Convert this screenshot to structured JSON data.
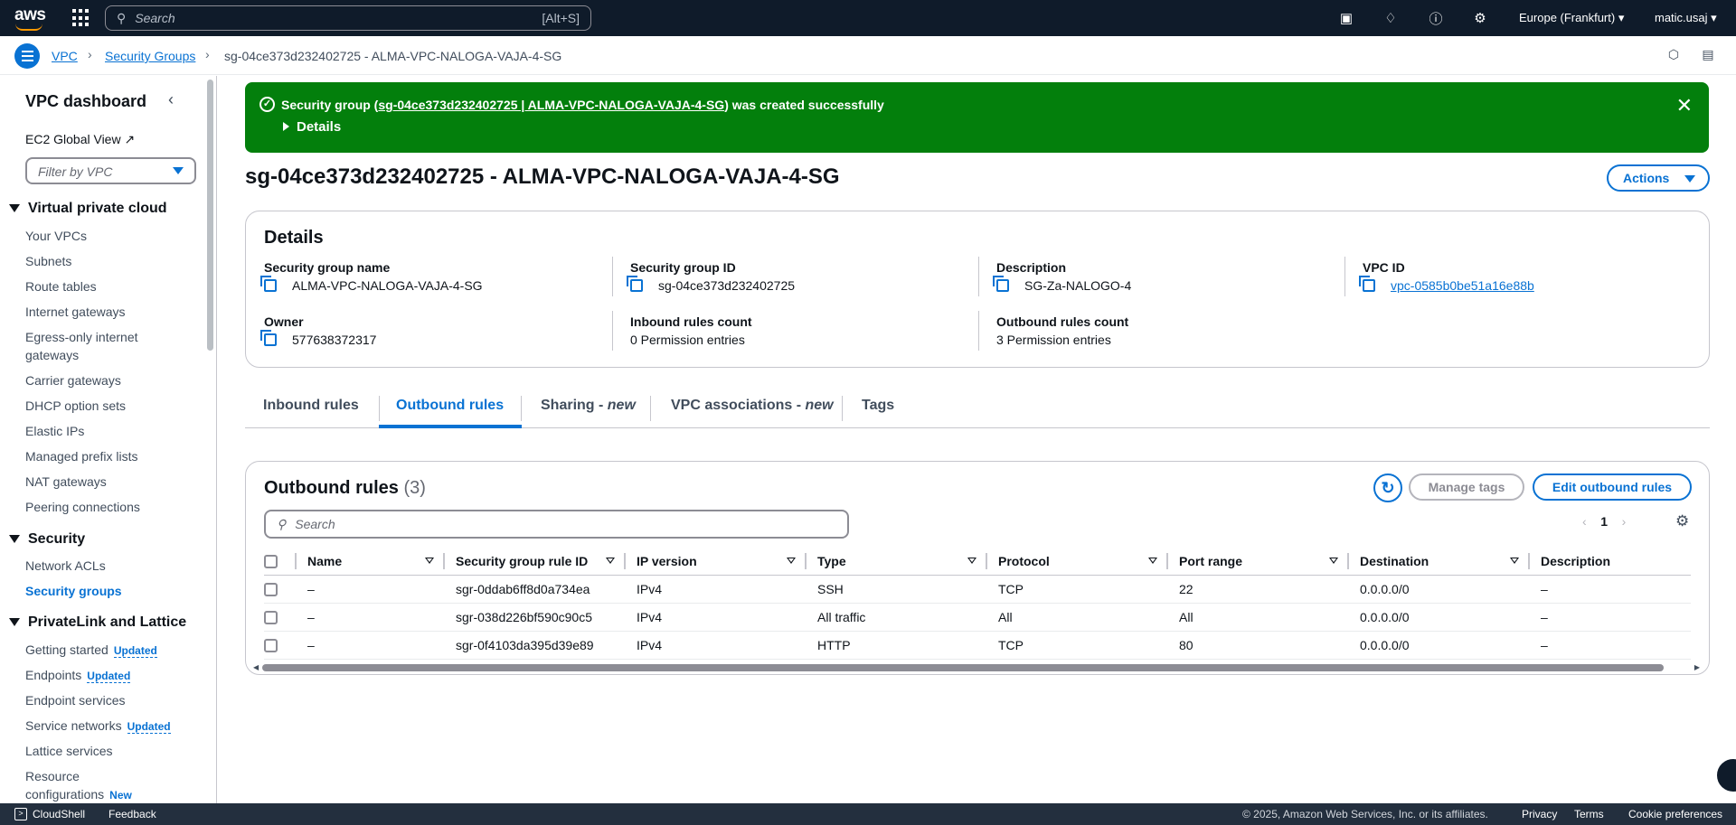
{
  "topnav": {
    "logo_text": "aws",
    "search_placeholder": "Search",
    "search_shortcut": "[Alt+S]",
    "region": "Europe (Frankfurt)",
    "user": "matic.usaj"
  },
  "breadcrumb": {
    "items": [
      "VPC",
      "Security Groups",
      "sg-04ce373d232402725 - ALMA-VPC-NALOGA-VAJA-4-SG"
    ]
  },
  "sidebar": {
    "title": "VPC dashboard",
    "ec2_global_view": "EC2 Global View",
    "filter_placeholder": "Filter by VPC",
    "sections": [
      {
        "title": "Virtual private cloud",
        "items": [
          "Your VPCs",
          "Subnets",
          "Route tables",
          "Internet gateways",
          "Egress-only internet gateways",
          "Carrier gateways",
          "DHCP option sets",
          "Elastic IPs",
          "Managed prefix lists",
          "NAT gateways",
          "Peering connections"
        ]
      },
      {
        "title": "Security",
        "items": [
          "Network ACLs",
          "Security groups"
        ]
      },
      {
        "title": "PrivateLink and Lattice",
        "items": [
          "Getting started",
          "Endpoints",
          "Endpoint services",
          "Service networks",
          "Lattice services",
          "Resource configurations"
        ]
      }
    ],
    "badges": {
      "updated": "Updated",
      "new": "New"
    }
  },
  "flash": {
    "prefix": "Security group (",
    "link": "sg-04ce373d232402725 | ALMA-VPC-NALOGA-VAJA-4-SG",
    "suffix": ") was created successfully",
    "details": "Details"
  },
  "page": {
    "title": "sg-04ce373d232402725 - ALMA-VPC-NALOGA-VAJA-4-SG",
    "actions_label": "Actions"
  },
  "details": {
    "heading": "Details",
    "fields": [
      {
        "label": "Security group name",
        "value": "ALMA-VPC-NALOGA-VAJA-4-SG"
      },
      {
        "label": "Security group ID",
        "value": "sg-04ce373d232402725"
      },
      {
        "label": "Description",
        "value": "SG-Za-NALOGO-4"
      },
      {
        "label": "VPC ID",
        "value": "vpc-0585b0be51a16e88b"
      },
      {
        "label": "Owner",
        "value": "577638372317"
      },
      {
        "label": "Inbound rules count",
        "value": "0 Permission entries"
      },
      {
        "label": "Outbound rules count",
        "value": "3 Permission entries"
      }
    ]
  },
  "tabs": [
    {
      "label": "Inbound rules",
      "suffix": ""
    },
    {
      "label": "Outbound rules",
      "suffix": ""
    },
    {
      "label": "Sharing - ",
      "suffix": "new"
    },
    {
      "label": "VPC associations - ",
      "suffix": "new"
    },
    {
      "label": "Tags",
      "suffix": ""
    }
  ],
  "outbound": {
    "title": "Outbound rules",
    "count": "(3)",
    "manage_tags": "Manage tags",
    "edit_label": "Edit outbound rules",
    "search_placeholder": "Search",
    "page": "1",
    "columns": [
      "Name",
      "Security group rule ID",
      "IP version",
      "Type",
      "Protocol",
      "Port range",
      "Destination",
      "Description"
    ],
    "rows": [
      [
        "–",
        "sgr-0ddab6ff8d0a734ea",
        "IPv4",
        "SSH",
        "TCP",
        "22",
        "0.0.0.0/0",
        "–"
      ],
      [
        "–",
        "sgr-038d226bf590c90c5",
        "IPv4",
        "All traffic",
        "All",
        "All",
        "0.0.0.0/0",
        "–"
      ],
      [
        "–",
        "sgr-0f4103da395d39e89",
        "IPv4",
        "HTTP",
        "TCP",
        "80",
        "0.0.0.0/0",
        "–"
      ]
    ]
  },
  "footer": {
    "cloudshell": "CloudShell",
    "feedback": "Feedback",
    "copyright": "© 2025, Amazon Web Services, Inc. or its affiliates.",
    "privacy": "Privacy",
    "terms": "Terms",
    "cookies": "Cookie preferences"
  },
  "colors": {
    "nav_bg": "#0f1b2a",
    "link": "#0972d3",
    "success": "#037f0c",
    "footer_bg": "#232f3e"
  }
}
